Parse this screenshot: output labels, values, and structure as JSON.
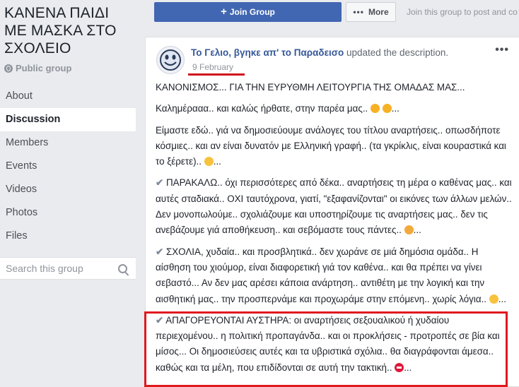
{
  "group": {
    "title": "ΚΑΝΕΝΑ ΠΑΙΔΙ ΜΕ ΜΑΣΚΑ ΣΤΟ ΣΧΟΛΕΙΟ",
    "privacy": "Public group"
  },
  "nav": [
    {
      "label": "About",
      "active": false
    },
    {
      "label": "Discussion",
      "active": true
    },
    {
      "label": "Members",
      "active": false
    },
    {
      "label": "Events",
      "active": false
    },
    {
      "label": "Videos",
      "active": false
    },
    {
      "label": "Photos",
      "active": false
    },
    {
      "label": "Files",
      "active": false
    }
  ],
  "search": {
    "placeholder": "Search this group"
  },
  "topbar": {
    "join_label": "Join Group",
    "more_label": "More",
    "join_hint": "Join this group to post and co"
  },
  "post": {
    "author": "Το Γελιο, βγηκε απ' το Παραδεισο",
    "action": "updated the description.",
    "date": "9 February",
    "p1": "ΚΑΝΟΝΙΣΜΟΣ... ΓΙΑ ΤΗΝ ΕΥΡΥΘΜΗ ΛΕΙΤΟΥΡΓΙΑ ΤΗΣ ΟΜΑΔΑΣ ΜΑΣ...",
    "p2": "Καλημέρααα.. και καλώς ήρθατε, στην παρέα μας..",
    "p3": "Είμαστε εδώ.. γιά να δημοσιεύουμε ανάλογες του τίτλου αναρτήσεις.. οπωσδήποτε κόσμιες.. και αν είναι δυνατόν με Ελληνική γραφή.. (τα γκρίκλις, είναι κουραστικά και το ξέρετε)..",
    "p4": "ΠΑΡΑΚΑΛΩ.. όχι περισσότερες από δέκα.. αναρτήσεις τη μέρα ο καθένας μας.. και αυτές σταδιακά.. ΟΧΙ ταυτόχρονα, γιατί, \"εξαφανίζονται\" οι εικόνες των άλλων μελών.. Δεν μονοπωλούμε.. σχολιάζουμε και υποστηρίζουμε τις αναρτήσεις μας.. δεν τις ανεβάζουμε γιά αποθήκευση.. και σεβόμαστε τους πάντες..",
    "p5": "ΣΧΟΛΙΑ, χυδαία.. και προσβλητικά.. δεν χωράνε σε μιά δημόσια ομάδα.. Η αίσθηση του χιούμορ, είναι διαφορετική γιά τον καθένα.. και θα πρέπει να γίνει σεβαστό... Αν δεν μας αρέσει κάποια ανάρτηση.. αντιθέτη με την λογική και την αισθητική μας.. την προσπερνάμε και προχωράμε στην επόμενη.. χωρίς λόγια..",
    "p6": "ΑΠΑΓΟΡΕΥΟΝΤΑΙ ΑΥΣΤΗΡΑ: οι αναρτήσεις σεξουαλικού ή χυδαίου περιεχομένου.. η πολιτική προπαγάνδα.. και οι προκλήσεις - προτροπές σε βία και μίσος... Οι δημοσιεύσεις αυτές και τα υβριστικά σχόλια.. θα διαγράφονται άμεσα.. καθώς και τα μέλη, που επιδίδονται σε αυτή την τακτική..",
    "ellipsis": "..."
  },
  "colors": {
    "accent": "#4267b2",
    "link": "#365899",
    "highlight": "#e0191e"
  },
  "icons": [
    "globe-icon",
    "plus-icon",
    "more-dots-icon",
    "search-icon",
    "smiley-avatar-icon",
    "checkmark-icon",
    "emoji-icon",
    "no-entry-icon",
    "post-menu-icon"
  ]
}
